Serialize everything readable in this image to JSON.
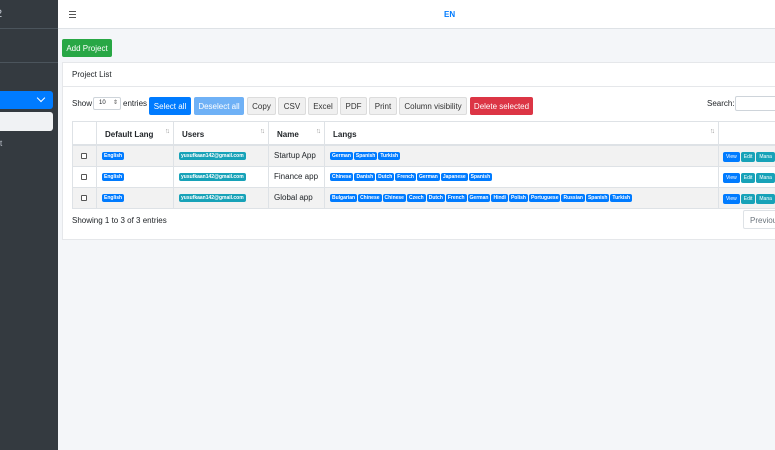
{
  "navbar": {
    "language": "EN"
  },
  "sidebar": {
    "brand_fragment": "2",
    "sub_item_fragment": "t"
  },
  "add_project_label": "Add Project",
  "card_title": "Project List",
  "length": {
    "show": "Show",
    "value": "10",
    "entries": "entries"
  },
  "buttons": {
    "select_all": "Select all",
    "deselect_all": "Deselect all",
    "copy": "Copy",
    "csv": "CSV",
    "excel": "Excel",
    "pdf": "PDF",
    "print": "Print",
    "column_visibility": "Column visibility",
    "delete_selected": "Delete selected"
  },
  "search_label": "Search:",
  "table": {
    "columns": [
      "Default Lang",
      "Users",
      "Name",
      "Langs"
    ],
    "rows": [
      {
        "default_lang": "English",
        "user": "yusufkaan142@gmail.com",
        "name": "Startup App",
        "langs": [
          "German",
          "Spanish",
          "Turkish"
        ]
      },
      {
        "default_lang": "English",
        "user": "yusufkaan142@gmail.com",
        "name": "Finance app",
        "langs": [
          "Chinese",
          "Danish",
          "Dutch",
          "French",
          "German",
          "Japanese",
          "Spanish"
        ]
      },
      {
        "default_lang": "English",
        "user": "yusufkaan142@gmail.com",
        "name": "Global app",
        "langs": [
          "Bulgarian",
          "Chinese",
          "Chinese",
          "Czech",
          "Dutch",
          "French",
          "German",
          "Hindi",
          "Polish",
          "Portuguese",
          "Russian",
          "Spanish",
          "Turkish"
        ]
      }
    ],
    "actions": {
      "view": "View",
      "edit": "Edit",
      "manage": "Mana"
    }
  },
  "info_text": "Showing 1 to 3 of 3 entries",
  "pagination": {
    "previous": "Previous"
  }
}
